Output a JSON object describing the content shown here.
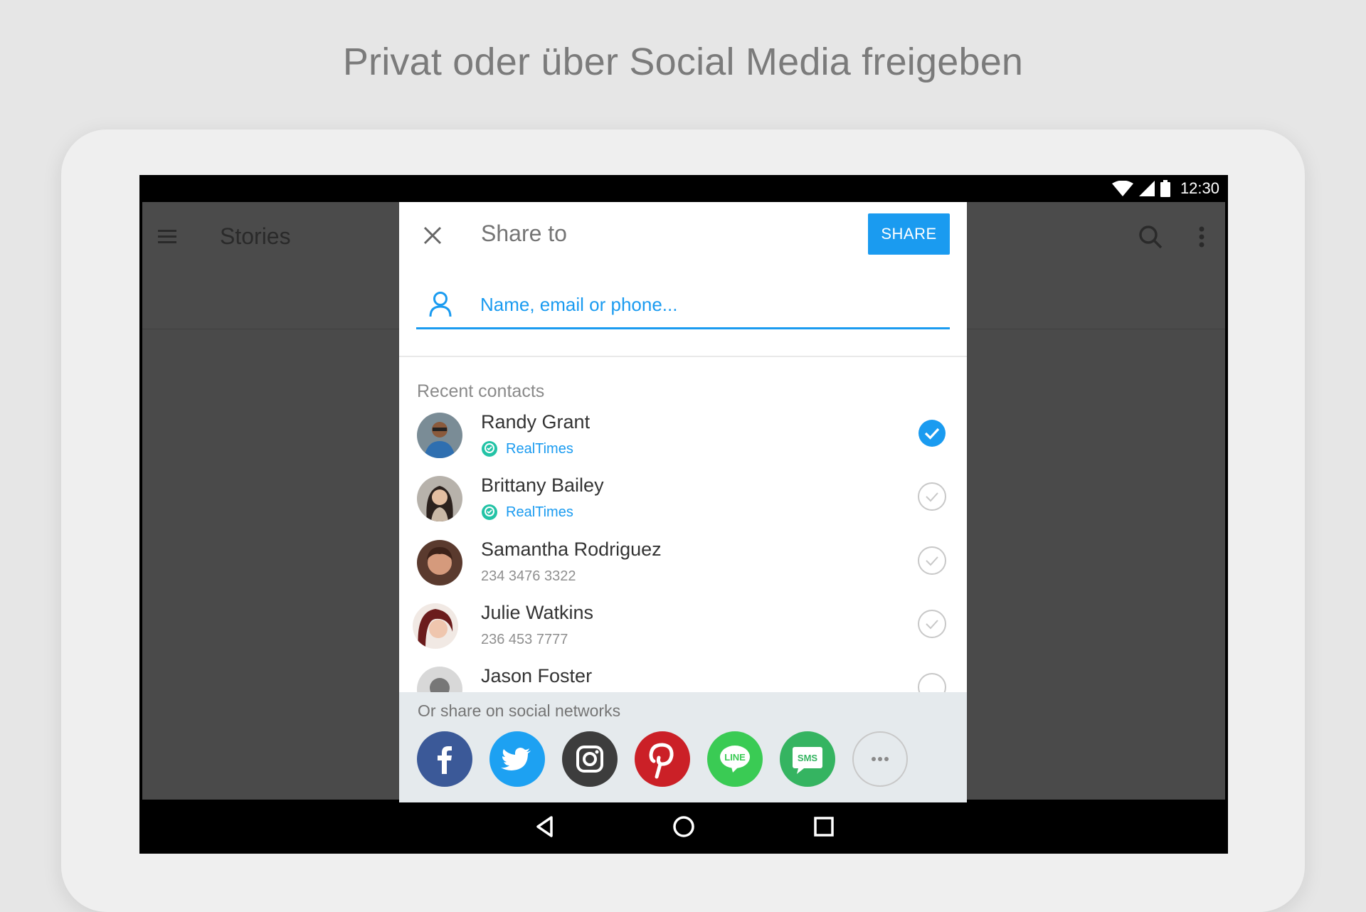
{
  "headline": "Privat oder über Social Media freigeben",
  "status_bar": {
    "time": "12:30",
    "icons": [
      "wifi-icon",
      "signal-icon",
      "battery-icon"
    ]
  },
  "app": {
    "title": "Stories",
    "icons": [
      "menu-icon",
      "search-icon",
      "more-vert-icon"
    ]
  },
  "dialog": {
    "title": "Share to",
    "share_label": "SHARE",
    "search_placeholder": "Name, email or phone...",
    "recent_label": "Recent contacts",
    "contacts": [
      {
        "name": "Randy Grant",
        "sub": "RealTimes",
        "sub_is_app": true,
        "selected": true
      },
      {
        "name": "Brittany Bailey",
        "sub": "RealTimes",
        "sub_is_app": true,
        "selected": false
      },
      {
        "name": "Samantha Rodriguez",
        "sub": "234 3476 3322",
        "sub_is_app": false,
        "selected": false
      },
      {
        "name": "Julie Watkins",
        "sub": "236 453 7777",
        "sub_is_app": false,
        "selected": false
      },
      {
        "name": "Jason Foster",
        "sub": "",
        "sub_is_app": false,
        "selected": false
      }
    ],
    "social_label": "Or share on social networks",
    "social": [
      {
        "name": "facebook",
        "color": "#3b5998"
      },
      {
        "name": "twitter",
        "color": "#1da1f2"
      },
      {
        "name": "instagram",
        "color": "#3d3d3d"
      },
      {
        "name": "pinterest",
        "color": "#cb2027"
      },
      {
        "name": "line",
        "color": "#3acb54",
        "text": "LINE"
      },
      {
        "name": "sms",
        "color": "#35b461",
        "text": "SMS"
      },
      {
        "name": "more",
        "color": "#e5eaed"
      }
    ]
  },
  "colors": {
    "accent": "#1a9bf0",
    "background": "#e6e6e6",
    "scrim": "#4a4a4a"
  }
}
